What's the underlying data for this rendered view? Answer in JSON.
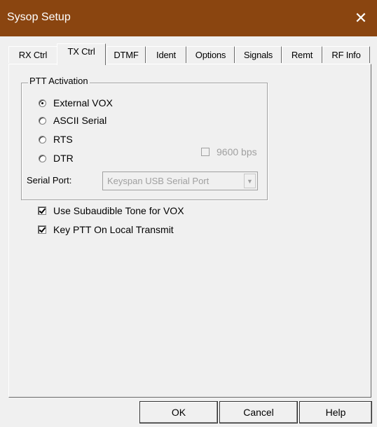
{
  "window": {
    "title": "Sysop Setup",
    "close_glyph": "✕",
    "colors": {
      "titlebar": "#8a4510",
      "face": "#f0f0f0"
    }
  },
  "tabs": [
    {
      "label": "RX Ctrl",
      "active": false
    },
    {
      "label": "TX Ctrl",
      "active": true
    },
    {
      "label": "DTMF",
      "active": false
    },
    {
      "label": "Ident",
      "active": false
    },
    {
      "label": "Options",
      "active": false
    },
    {
      "label": "Signals",
      "active": false
    },
    {
      "label": "Remt",
      "active": false
    },
    {
      "label": "RF Info",
      "active": false
    }
  ],
  "ptt_group": {
    "title": "PTT Activation",
    "radios": [
      {
        "label": "External VOX",
        "checked": true
      },
      {
        "label": "ASCII Serial",
        "checked": false
      },
      {
        "label": "RTS",
        "checked": false
      },
      {
        "label": "DTR",
        "checked": false
      }
    ],
    "baud_checkbox": {
      "label": "9600 bps",
      "checked": false,
      "disabled": true
    },
    "serial_port_label": "Serial Port:",
    "serial_port_value": "Keyspan USB Serial Port"
  },
  "options": [
    {
      "label": "Use Subaudible Tone for VOX",
      "checked": true
    },
    {
      "label": "Key PTT On Local Transmit",
      "checked": true
    }
  ],
  "buttons": {
    "ok": "OK",
    "cancel": "Cancel",
    "help": "Help"
  }
}
